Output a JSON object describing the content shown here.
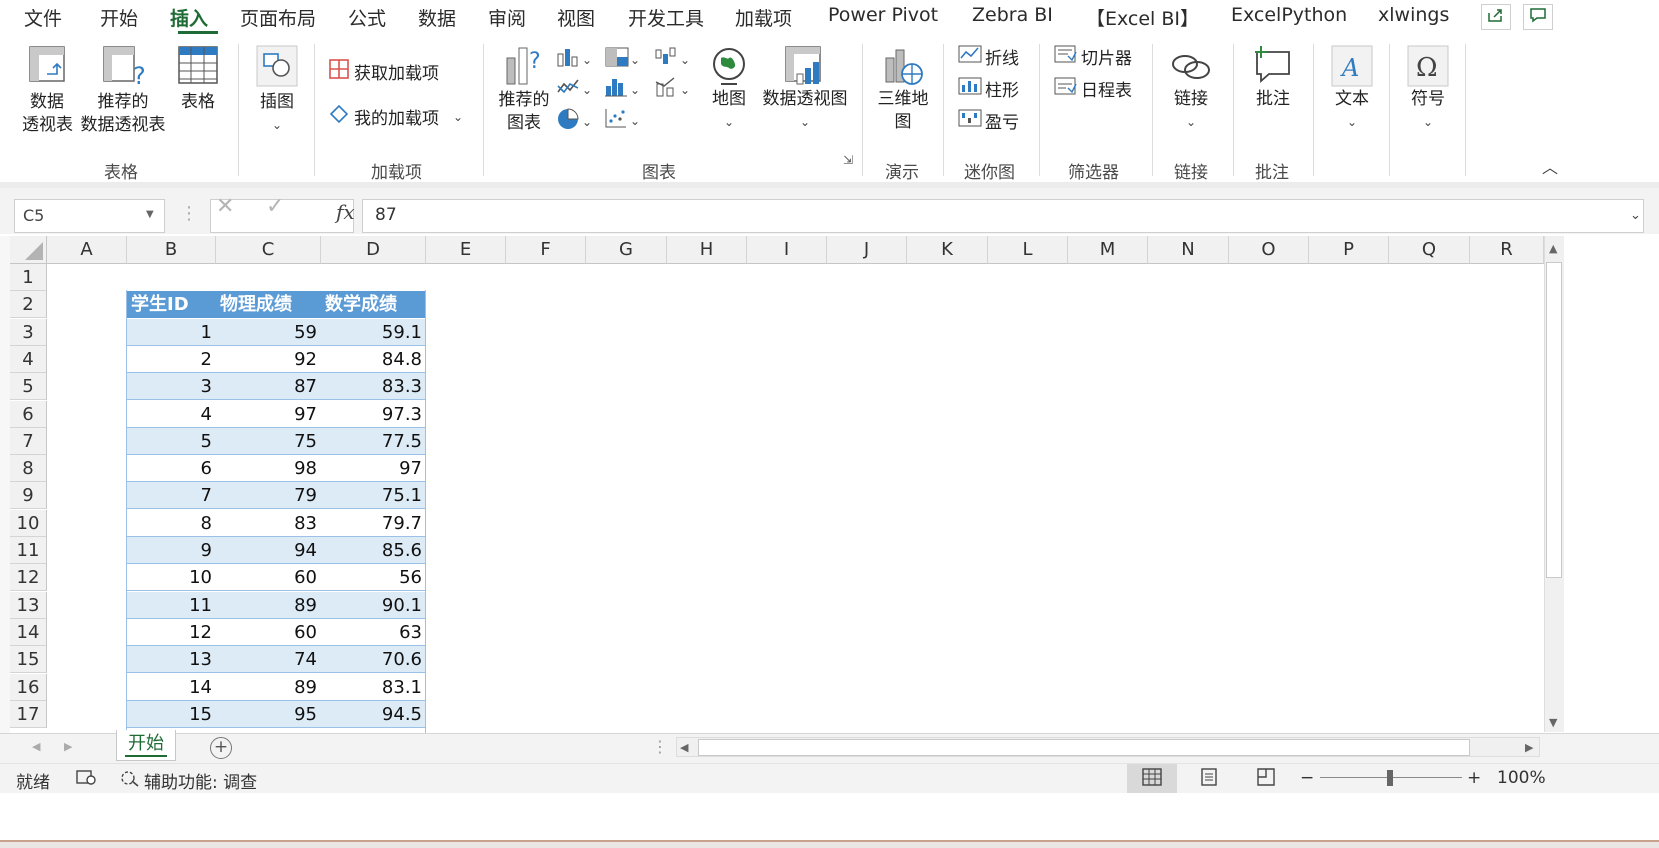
{
  "tabs": [
    "文件",
    "开始",
    "插入",
    "页面布局",
    "公式",
    "数据",
    "审阅",
    "视图",
    "开发工具",
    "加载项",
    "Power Pivot",
    "Zebra BI",
    "【Excel BI】",
    "ExcelPython",
    "xlwings"
  ],
  "ribbon": {
    "table_group": {
      "label": "表格",
      "pivot_table": "数据\n透视表",
      "recommended_pivot": "推荐的\n数据透视表",
      "table": "表格"
    },
    "illustrations": {
      "label": "插图"
    },
    "addins": {
      "label": "加载项",
      "get_addins": "获取加载项",
      "my_addins": "我的加载项"
    },
    "charts": {
      "label": "图表",
      "recommended": "推荐的\n图表",
      "maps": "地图",
      "pivot_chart": "数据透视图"
    },
    "tours": {
      "label": "演示",
      "map3d": "三维地\n图"
    },
    "sparklines": {
      "label": "迷你图",
      "line": "折线",
      "column": "柱形",
      "winloss": "盈亏"
    },
    "filters": {
      "label": "筛选器",
      "slicer": "切片器",
      "timeline": "日程表"
    },
    "links": {
      "label": "链接",
      "link": "链接"
    },
    "comments": {
      "label": "批注",
      "comment": "批注"
    },
    "text": {
      "label": "文本"
    },
    "symbols": {
      "label": "符号"
    }
  },
  "formula_bar": {
    "name_box": "C5",
    "formula": "87",
    "fx": "fx"
  },
  "columns": [
    "A",
    "B",
    "C",
    "D",
    "E",
    "F",
    "G",
    "H",
    "I",
    "J",
    "K",
    "L",
    "M",
    "N",
    "O",
    "P",
    "Q",
    "R"
  ],
  "rows": [
    "1",
    "2",
    "3",
    "4",
    "5",
    "6",
    "7",
    "8",
    "9",
    "10",
    "11",
    "12",
    "13",
    "14",
    "15",
    "16",
    "17"
  ],
  "table": {
    "headers": [
      "学生ID",
      "物理成绩",
      "数学成绩"
    ],
    "rows": [
      [
        "1",
        "59",
        "59.1"
      ],
      [
        "2",
        "92",
        "84.8"
      ],
      [
        "3",
        "87",
        "83.3"
      ],
      [
        "4",
        "97",
        "97.3"
      ],
      [
        "5",
        "75",
        "77.5"
      ],
      [
        "6",
        "98",
        "97"
      ],
      [
        "7",
        "79",
        "75.1"
      ],
      [
        "8",
        "83",
        "79.7"
      ],
      [
        "9",
        "94",
        "85.6"
      ],
      [
        "10",
        "60",
        "56"
      ],
      [
        "11",
        "89",
        "90.1"
      ],
      [
        "12",
        "60",
        "63"
      ],
      [
        "13",
        "74",
        "70.6"
      ],
      [
        "14",
        "89",
        "83.1"
      ],
      [
        "15",
        "95",
        "94.5"
      ]
    ]
  },
  "sheet_tab": "开始",
  "status": {
    "ready": "就绪",
    "accessibility": "辅助功能: 调查",
    "zoom": "100%"
  }
}
